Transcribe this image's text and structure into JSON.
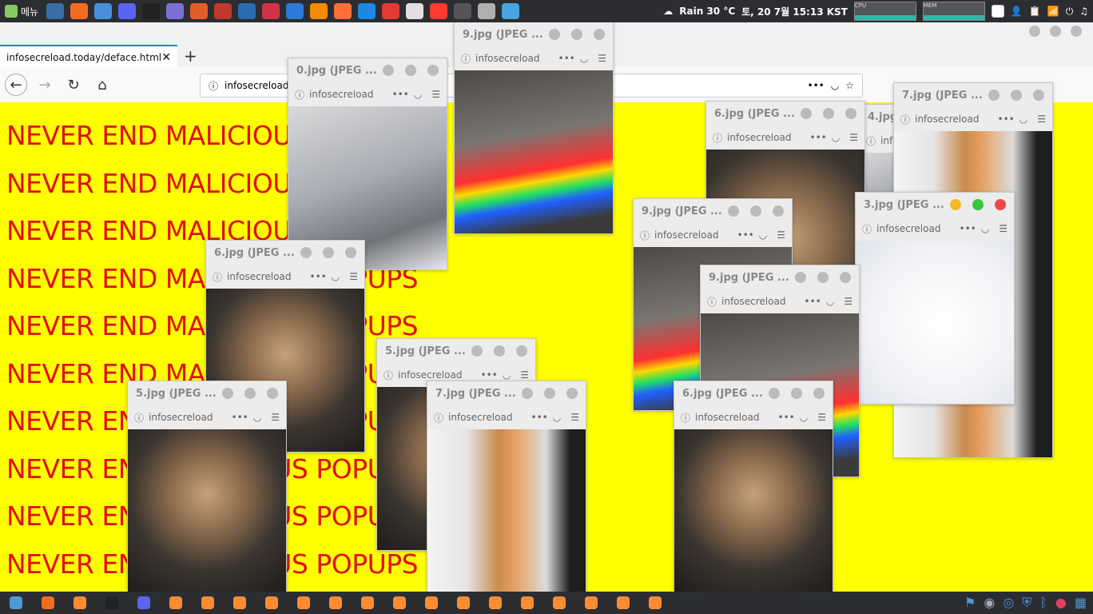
{
  "top_panel": {
    "menu_label": "메뉴",
    "weather": "Rain 30 °C",
    "datetime": "토, 20  7월 15:13 KST",
    "cpu_label": "CPU",
    "mem_label": "MEM",
    "launcher_colors": [
      "#3a6ea5",
      "#f36d21",
      "#4a90d9",
      "#5865f2",
      "#222",
      "#7b6fd6",
      "#e55b2a",
      "#c0392b",
      "#2b6cb0",
      "#d0344c",
      "#2a7ad6",
      "#f28c00",
      "#ff6d3b",
      "#1e88e5",
      "#e53935",
      "#e0e0e0",
      "#ff3b30",
      "#555",
      "#b0b0b0",
      "#4aa3df"
    ]
  },
  "browser": {
    "tab_title": "infosecreload.today/deface.html",
    "url_text": "infosecreload.today/deface.html",
    "new_tab": "+"
  },
  "content": {
    "lines": [
      "NEVER END MALICIOUS POPUPS",
      "NEVER END MALICIOUS POPUPS",
      "NEVER END MALICIOUS POPUPS",
      "NEVER END MALICIOUS POPUPS",
      "NEVER END MALICIOUS POPUPS",
      "NEVER END MALICIOUS POPUPS",
      "NEVER END MALICIOUS POPUPS",
      "NEVER END MALICIOUS POPUPS",
      "NEVER END MALICIOUS POPUPS",
      "NEVER END MALICIOUS POPUPS"
    ]
  },
  "popups": [
    {
      "title": "0.jpg (JPEG ...",
      "url": "infosecreload",
      "theme": "gray"
    },
    {
      "title": "9.jpg (JPEG ...",
      "url": "infosecreload",
      "theme": "rainbow"
    },
    {
      "title": "4.jpg (JPEG ...",
      "url": "infosecreload",
      "theme": "gray"
    },
    {
      "title": "6.jpg (JPEG ...",
      "url": "infosecreload",
      "theme": "lights"
    },
    {
      "title": "7.jpg (JPEG ...",
      "url": "infosecreload",
      "theme": "box"
    },
    {
      "title": "3.jpg (JPEG ...",
      "url": "infosecreload",
      "theme": "white"
    },
    {
      "title": "9.jpg (JPEG ...",
      "url": "infosecreload",
      "theme": "rainbow"
    },
    {
      "title": "9.jpg (JPEG ...",
      "url": "infosecreload",
      "theme": "rainbow"
    },
    {
      "title": "6.jpg (JPEG ...",
      "url": "infosecreload",
      "theme": "lights"
    },
    {
      "title": "5.jpg (JPEG ...",
      "url": "infosecreload",
      "theme": "lights"
    },
    {
      "title": "5.jpg (JPEG ...",
      "url": "infosecreload",
      "theme": "lights"
    },
    {
      "title": "7.jpg (JPEG ...",
      "url": "infosecreload",
      "theme": "box"
    },
    {
      "title": "6.jpg (JPEG ...",
      "url": "infosecreload",
      "theme": "lights"
    }
  ],
  "taskbar": {
    "colors": [
      "#4a9ad6",
      "#f36d21",
      "#ff8c32",
      "#222",
      "#5865f2",
      "#ff8c32",
      "#ff8c32",
      "#ff8c32",
      "#ff8c32",
      "#ff8c32",
      "#ff8c32",
      "#ff8c32",
      "#ff8c32",
      "#ff8c32",
      "#ff8c32",
      "#ff8c32",
      "#ff8c32",
      "#ff8c32",
      "#ff8c32",
      "#ff8c32",
      "#ff8c32"
    ]
  }
}
